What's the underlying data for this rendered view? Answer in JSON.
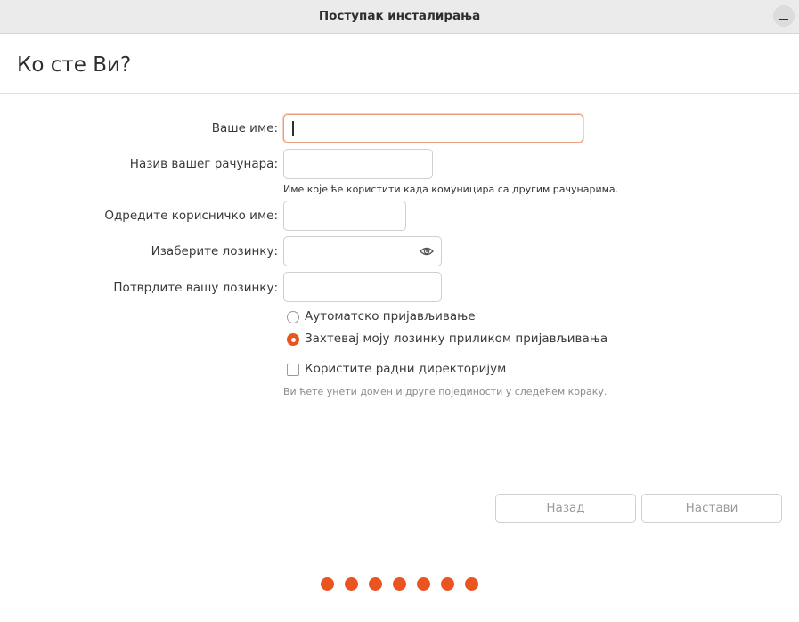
{
  "window": {
    "title": "Поступак инсталирања"
  },
  "header": {
    "heading": "Ко сте Ви?"
  },
  "form": {
    "name_label": "Ваше име:",
    "name_value": "",
    "computer_label": "Назив вашег рачунара:",
    "computer_value": "",
    "computer_hint": "Име које ће користити када комуницира са другим рачунарима.",
    "username_label": "Одредите корисничко име:",
    "username_value": "",
    "password_label": "Изаберите лозинку:",
    "password_value": "",
    "confirm_label": "Потврдите вашу лозинку:",
    "confirm_value": "",
    "login_options": [
      {
        "label": "Аутоматско пријављивање",
        "selected": false
      },
      {
        "label": "Захтевај моју лозинку приликом пријављивања",
        "selected": true
      }
    ],
    "active_directory_label": "Користите радни директоријум",
    "active_directory_checked": false,
    "active_directory_hint": "Ви ћете унети домен и друге појединости у следећем кораку."
  },
  "buttons": {
    "back": "Назад",
    "continue": "Настави"
  },
  "progress": {
    "total_steps": 7,
    "completed_steps": 7
  },
  "colors": {
    "accent": "#e95420",
    "focus_border": "#e9a07f"
  },
  "icons": {
    "password_reveal": "eye-icon",
    "window_minimize": "minimize-icon"
  }
}
